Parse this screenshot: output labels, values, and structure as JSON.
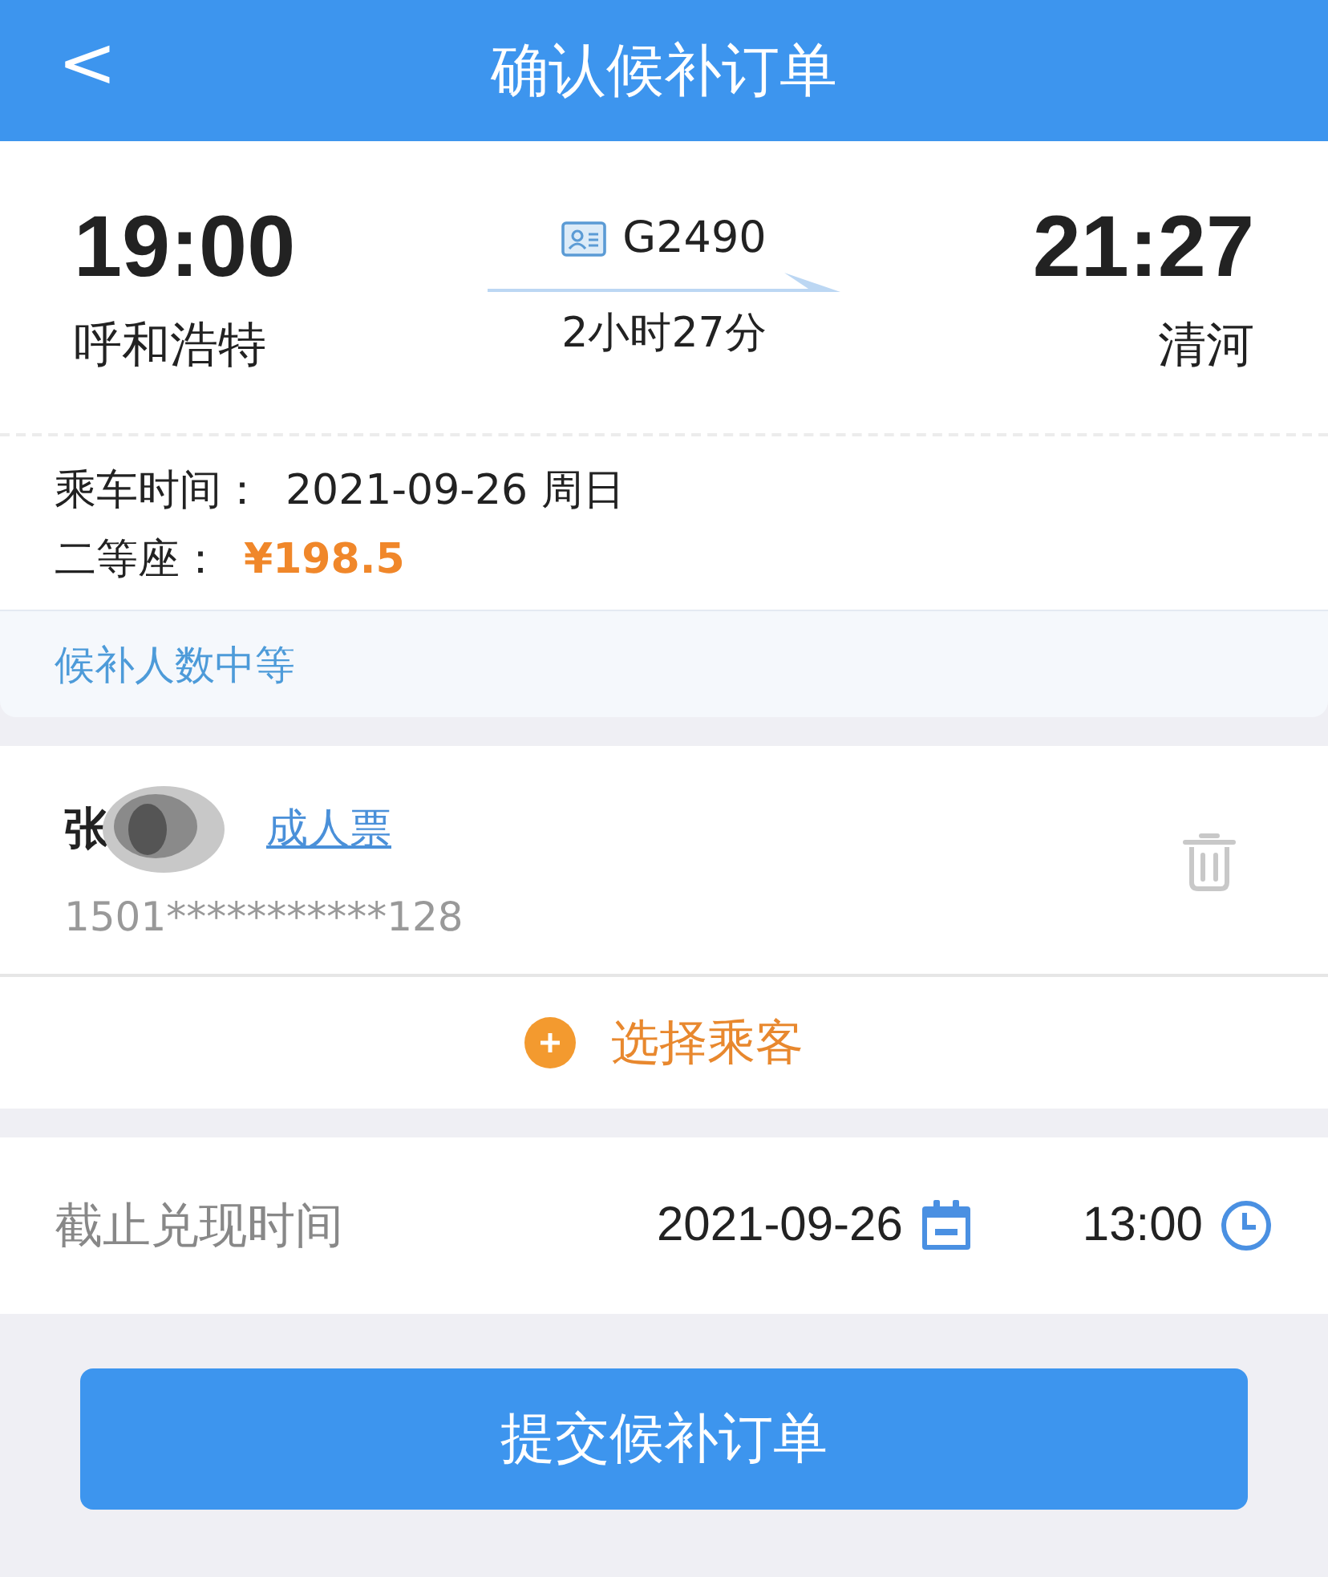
{
  "header": {
    "back": "<",
    "title": "确认候补订单"
  },
  "train": {
    "depart_time": "19:00",
    "depart_station": "呼和浩特",
    "number": "G2490",
    "duration": "2小时27分",
    "arrive_time": "21:27",
    "arrive_station": "清河"
  },
  "info": [
    {
      "label": "乘车时间：",
      "value": "2021-09-26 周日",
      "kind": "plain"
    },
    {
      "label": "二等座：",
      "value": "¥198.5",
      "kind": "price"
    }
  ],
  "hint": "候补人数中等",
  "passengers": [
    {
      "name": "张",
      "redacted": true,
      "ticket_type": "成人票",
      "id_number": "1501***********128"
    }
  ],
  "add_passenger": "选择乘客",
  "deadline": {
    "label": "截止兑现时间",
    "date": "2021-09-26",
    "time": "13:00"
  },
  "submit": "提交候补订单"
}
